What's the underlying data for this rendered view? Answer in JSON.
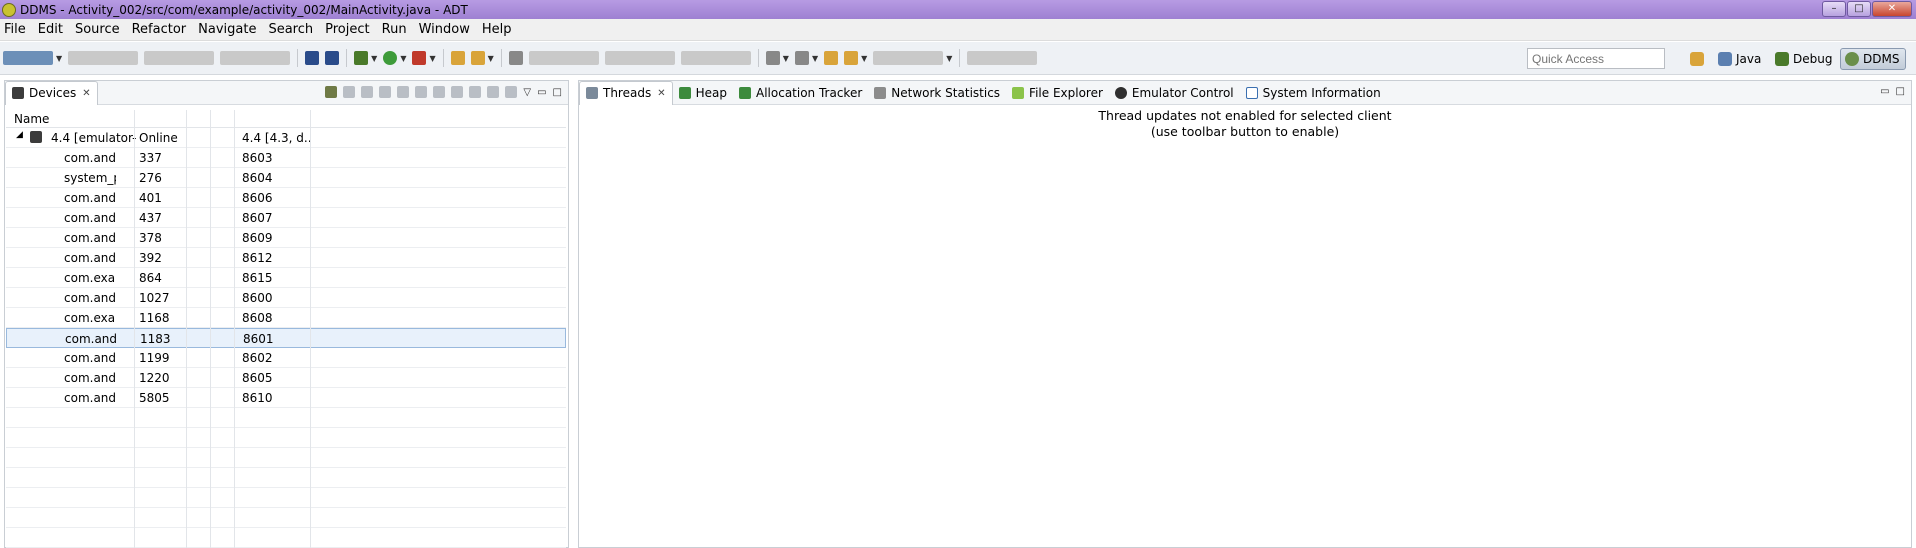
{
  "window": {
    "title": "DDMS - Activity_002/src/com/example/activity_002/MainActivity.java - ADT"
  },
  "menu": [
    "File",
    "Edit",
    "Source",
    "Refactor",
    "Navigate",
    "Search",
    "Project",
    "Run",
    "Window",
    "Help"
  ],
  "toolbar": {
    "quick_access_placeholder": "Quick Access"
  },
  "perspectives": {
    "java": "Java",
    "debug": "Debug",
    "ddms": "DDMS"
  },
  "devices_panel": {
    "tab_label": "Devices",
    "column_header": "Name",
    "device": {
      "name": "4.4 [emulator-",
      "state": "Online",
      "version": "4.4 [4.3, d..."
    },
    "processes": [
      {
        "name": "com.andro",
        "pid": "337",
        "port": "8603"
      },
      {
        "name": "system_prc",
        "pid": "276",
        "port": "8604"
      },
      {
        "name": "com.andro",
        "pid": "401",
        "port": "8606"
      },
      {
        "name": "com.andro",
        "pid": "437",
        "port": "8607"
      },
      {
        "name": "com.andro",
        "pid": "378",
        "port": "8609"
      },
      {
        "name": "com.andro",
        "pid": "392",
        "port": "8612"
      },
      {
        "name": "com.examp",
        "pid": "864",
        "port": "8615"
      },
      {
        "name": "com.andro",
        "pid": "1027",
        "port": "8600"
      },
      {
        "name": "com.examp",
        "pid": "1168",
        "port": "8608"
      },
      {
        "name": "com.andro",
        "pid": "1183",
        "port": "8601",
        "selected": true
      },
      {
        "name": "com.andro",
        "pid": "1199",
        "port": "8602"
      },
      {
        "name": "com.andro",
        "pid": "1220",
        "port": "8605"
      },
      {
        "name": "com.andro",
        "pid": "5805",
        "port": "8610"
      }
    ]
  },
  "right_panel": {
    "tabs": [
      "Threads",
      "Heap",
      "Allocation Tracker",
      "Network Statistics",
      "File Explorer",
      "Emulator Control",
      "System Information"
    ],
    "active_tab": "Threads",
    "message_line1": "Thread updates not enabled for selected client",
    "message_line2": "(use toolbar button to enable)"
  }
}
